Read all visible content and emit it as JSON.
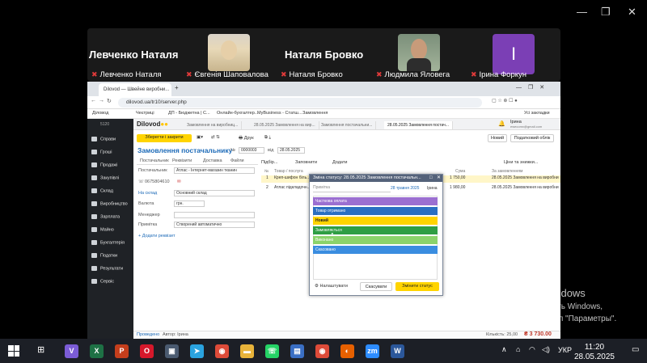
{
  "zoom": {
    "big_names": [
      "Левченко Наталя",
      "Наталя Бровко"
    ],
    "avatar_letter": "І",
    "participants": [
      "Левченко Наталя",
      "Євгенія Шаповалова",
      "Наталя Бровко",
      "Людмила Яловега",
      "Ірина Форкун"
    ],
    "window_controls": [
      "—",
      "❐",
      "✕"
    ]
  },
  "browser": {
    "tabs": [
      {
        "label": "Dilovod — Швейне виробни..."
      },
      {
        "label": "+"
      }
    ],
    "url": "dilovod.ua/tr10/server.php",
    "bookmarks": [
      "Діловод",
      "Чеєтриці",
      "ДП - Бюджетна | С...",
      "Онлайн-бухгалтер...",
      "MyBusiness - Статш...",
      "Замовлення",
      "Усі закладки"
    ]
  },
  "app": {
    "logo": "Dilovod",
    "version": "5120",
    "sidebar": [
      "Справи",
      "Гроші",
      "Продажі",
      "Закупівлі",
      "Склад",
      "Виробництво",
      "Зарплата",
      "Майно",
      "Бухгалтерія",
      "Податки",
      "Результати",
      "Сервіс"
    ],
    "doc_tabs": [
      "Замовлення на виробниц...",
      "28.05.2025 Замовлення на вир...",
      "Замовлення постачальни...",
      "28.05.2025 Замовлення постач..."
    ],
    "user_name": "Ірина",
    "user_email": "ewecomx@gmail.com",
    "toolbar": {
      "save_close": "Зберегти і закрити",
      "print": "Друк",
      "new": "Новий",
      "tax_doc": "Податковий облік"
    },
    "title": "Замовлення постачальнику",
    "doc_no_label": "№",
    "doc_no": "0000003",
    "from_label": "від",
    "doc_date": "28.05.2025",
    "form_tabs": [
      "Постачальник",
      "Реквізити",
      "Доставка",
      "Файли"
    ],
    "fields": {
      "supplier_label": "Постачальник",
      "supplier": "Атлас - Інтернет-магазин тканин",
      "phone": "0675804610",
      "warehouse_label": "На склад",
      "warehouse": "Основний склад",
      "currency_label": "Валюта",
      "currency": "грн.",
      "manager_label": "Менеджер",
      "manager": "",
      "note_label": "Примітка",
      "note": "Створений автоматично",
      "add_detail": "+ Додати реквізит"
    },
    "grid_toolbar": [
      "Підбір...",
      "Заповнити",
      "Додати",
      "Ціни та знижки..."
    ],
    "grid_headers": [
      "№",
      "Товар / послуга",
      "Сума",
      "За замовленням"
    ],
    "rows": [
      {
        "n": "1",
        "item": "Креп-шифон біль...",
        "sum": "1 750,00",
        "ref": "28.05.2025 Замовлення на виробни"
      },
      {
        "n": "2",
        "item": "Атлас підкладочн...",
        "sum": "1 980,00",
        "ref": "28.05.2025 Замовлення на виробни"
      }
    ],
    "footer_left": "Проведено",
    "footer_author": "Автор: Ірина",
    "footer_qty": "Кількість: 25,00",
    "footer_total": "₴ 3 730.00"
  },
  "modal": {
    "title": "Зміна статусу: 28.05.2025 Замовлення постачальн...",
    "note_placeholder": "Примітка",
    "date": "28 травня 2025",
    "user": "Ірина",
    "statuses": [
      {
        "label": "Часткова оплата",
        "color": "#9b6fd1"
      },
      {
        "label": "Товар отримано",
        "color": "#2a6fc2"
      },
      {
        "label": "Новий",
        "color": "#ffd400"
      },
      {
        "label": "Замовляється",
        "color": "#2f9e44"
      },
      {
        "label": "Виконано",
        "color": "#8bd36b"
      },
      {
        "label": "Скасовано",
        "color": "#3a8de0"
      }
    ],
    "settings": "Налаштувати",
    "cancel": "Скасувати",
    "change": "Змінити статус"
  },
  "watermark": {
    "line1": "Активация Windows",
    "line2": "Чтобы активировать Windows,",
    "line3": "перейдите в раздел \"Параметры\"."
  },
  "taskbar": {
    "lang": "УКР",
    "time": "11:20",
    "date": "28.05.2025",
    "apps": [
      {
        "name": "viber",
        "glyph": "V",
        "color": "#7b5cd6"
      },
      {
        "name": "excel",
        "glyph": "X",
        "color": "#1e7145"
      },
      {
        "name": "powerpoint",
        "glyph": "P",
        "color": "#c43e1c"
      },
      {
        "name": "opera",
        "glyph": "O",
        "color": "#d6182b"
      },
      {
        "name": "scanner",
        "glyph": "▣",
        "color": "#4a5a70"
      },
      {
        "name": "telegram",
        "glyph": "➤",
        "color": "#2aa3df"
      },
      {
        "name": "chrome",
        "glyph": "◉",
        "color": "#dd4b39"
      },
      {
        "name": "explorer",
        "glyph": "▬",
        "color": "#e8b33a"
      },
      {
        "name": "whatsapp",
        "glyph": "☏",
        "color": "#25d366"
      },
      {
        "name": "files",
        "glyph": "▤",
        "color": "#3a6fc4"
      },
      {
        "name": "chrome2",
        "glyph": "◉",
        "color": "#dd4b39"
      },
      {
        "name": "firefox",
        "glyph": "◐",
        "color": "#e66000"
      },
      {
        "name": "zoom",
        "glyph": "zm",
        "color": "#2d8cff"
      },
      {
        "name": "word",
        "glyph": "W",
        "color": "#2b579a"
      }
    ]
  }
}
